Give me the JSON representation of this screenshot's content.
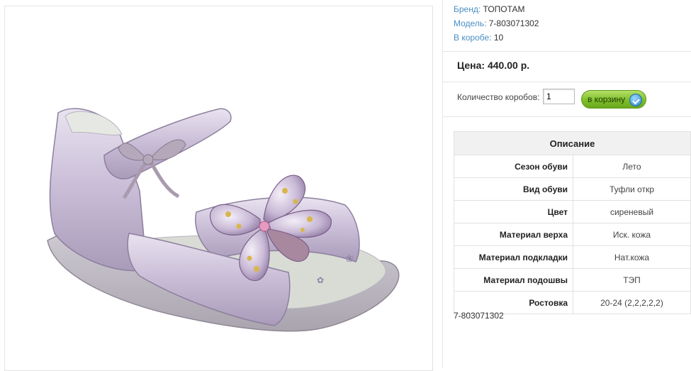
{
  "product": {
    "brand_label": "Бренд:",
    "brand_value": "ТОПОТАМ",
    "model_label": "Модель:",
    "model_value": "7-803071302",
    "box_label": "В коробе:",
    "box_value": "10",
    "price_text": "Цена: 440.00 р.",
    "qty_label": "Количество коробов:",
    "qty_value": "1",
    "cart_button": "в корзину",
    "cart_icon": "check-circle-icon",
    "sku_text": "7-803071302"
  },
  "specs": {
    "header": "Описание",
    "rows": [
      {
        "key": "Сезон обуви",
        "value": "Лето"
      },
      {
        "key": "Вид обуви",
        "value": "Туфли откр"
      },
      {
        "key": "Цвет",
        "value": "сиреневый"
      },
      {
        "key": "Материал верха",
        "value": "Иск. кожа"
      },
      {
        "key": "Материал подкладки",
        "value": "Нат.кожа"
      },
      {
        "key": "Материал подошвы",
        "value": "ТЭП"
      },
      {
        "key": "Ростовка",
        "value": "20-24 (2,2,2,2,2)"
      }
    ]
  },
  "colors": {
    "link_blue": "#4a8fc4",
    "button_green": "#7fbf2a",
    "table_header_bg": "#f1f1f1",
    "shoe_lilac": "#c9bdd6"
  }
}
